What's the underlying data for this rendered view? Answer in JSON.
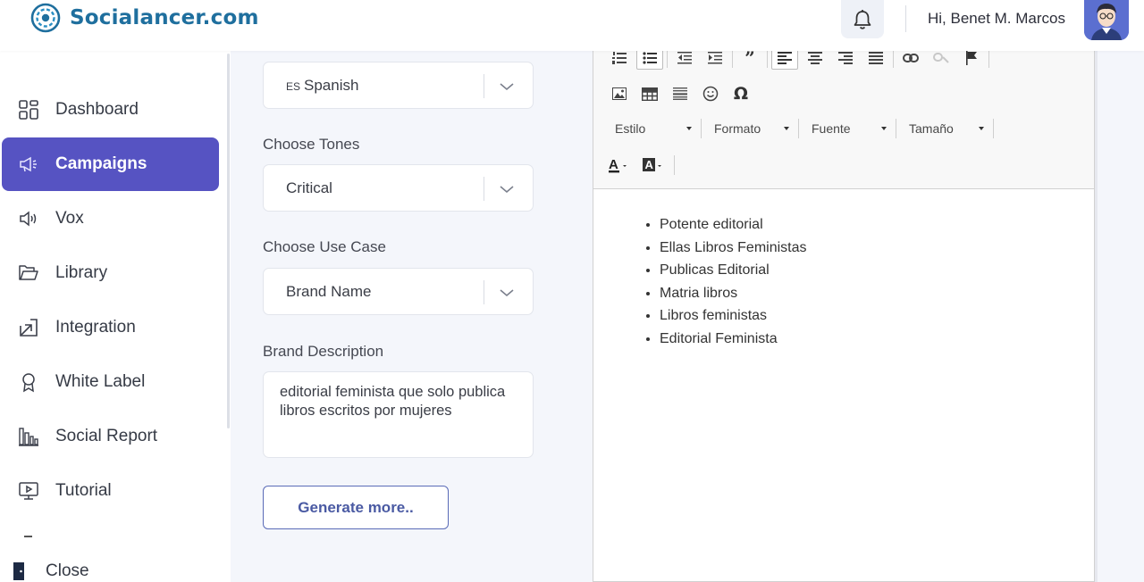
{
  "brand": {
    "name": "Socialancer.com",
    "color": "#1f6f9e"
  },
  "header": {
    "greeting": "Hi, Benet M. Marcos"
  },
  "sidebar": {
    "items": [
      {
        "label": "Dashboard",
        "icon": "dashboard-icon"
      },
      {
        "label": "Campaigns",
        "icon": "megaphone-icon",
        "active": true
      },
      {
        "label": "Vox",
        "icon": "speaker-icon"
      },
      {
        "label": "Library",
        "icon": "folder-icon"
      },
      {
        "label": "Integration",
        "icon": "arrow-box-icon"
      },
      {
        "label": "White Label",
        "icon": "award-icon"
      },
      {
        "label": "Social Report",
        "icon": "bar-chart-icon"
      },
      {
        "label": "Tutorial",
        "icon": "video-icon"
      }
    ],
    "close_label": "Close",
    "active_color": "#5653c2"
  },
  "form": {
    "language": {
      "code": "ES",
      "value": "Spanish"
    },
    "tones": {
      "label": "Choose Tones",
      "value": "Critical"
    },
    "use_case": {
      "label": "Choose Use Case",
      "value": "Brand Name"
    },
    "brand_description": {
      "label": "Brand Description",
      "value": "editorial feminista que solo publica libros escritos por mujeres"
    },
    "generate_button": "Generate more.."
  },
  "editor": {
    "dropdowns": [
      "Estilo",
      "Formato",
      "Fuente",
      "Tamaño"
    ],
    "content": [
      "Potente editorial",
      "Ellas Libros Feministas",
      "Publicas Editorial",
      "Matria libros",
      "Libros feministas",
      "Editorial Feminista"
    ]
  }
}
